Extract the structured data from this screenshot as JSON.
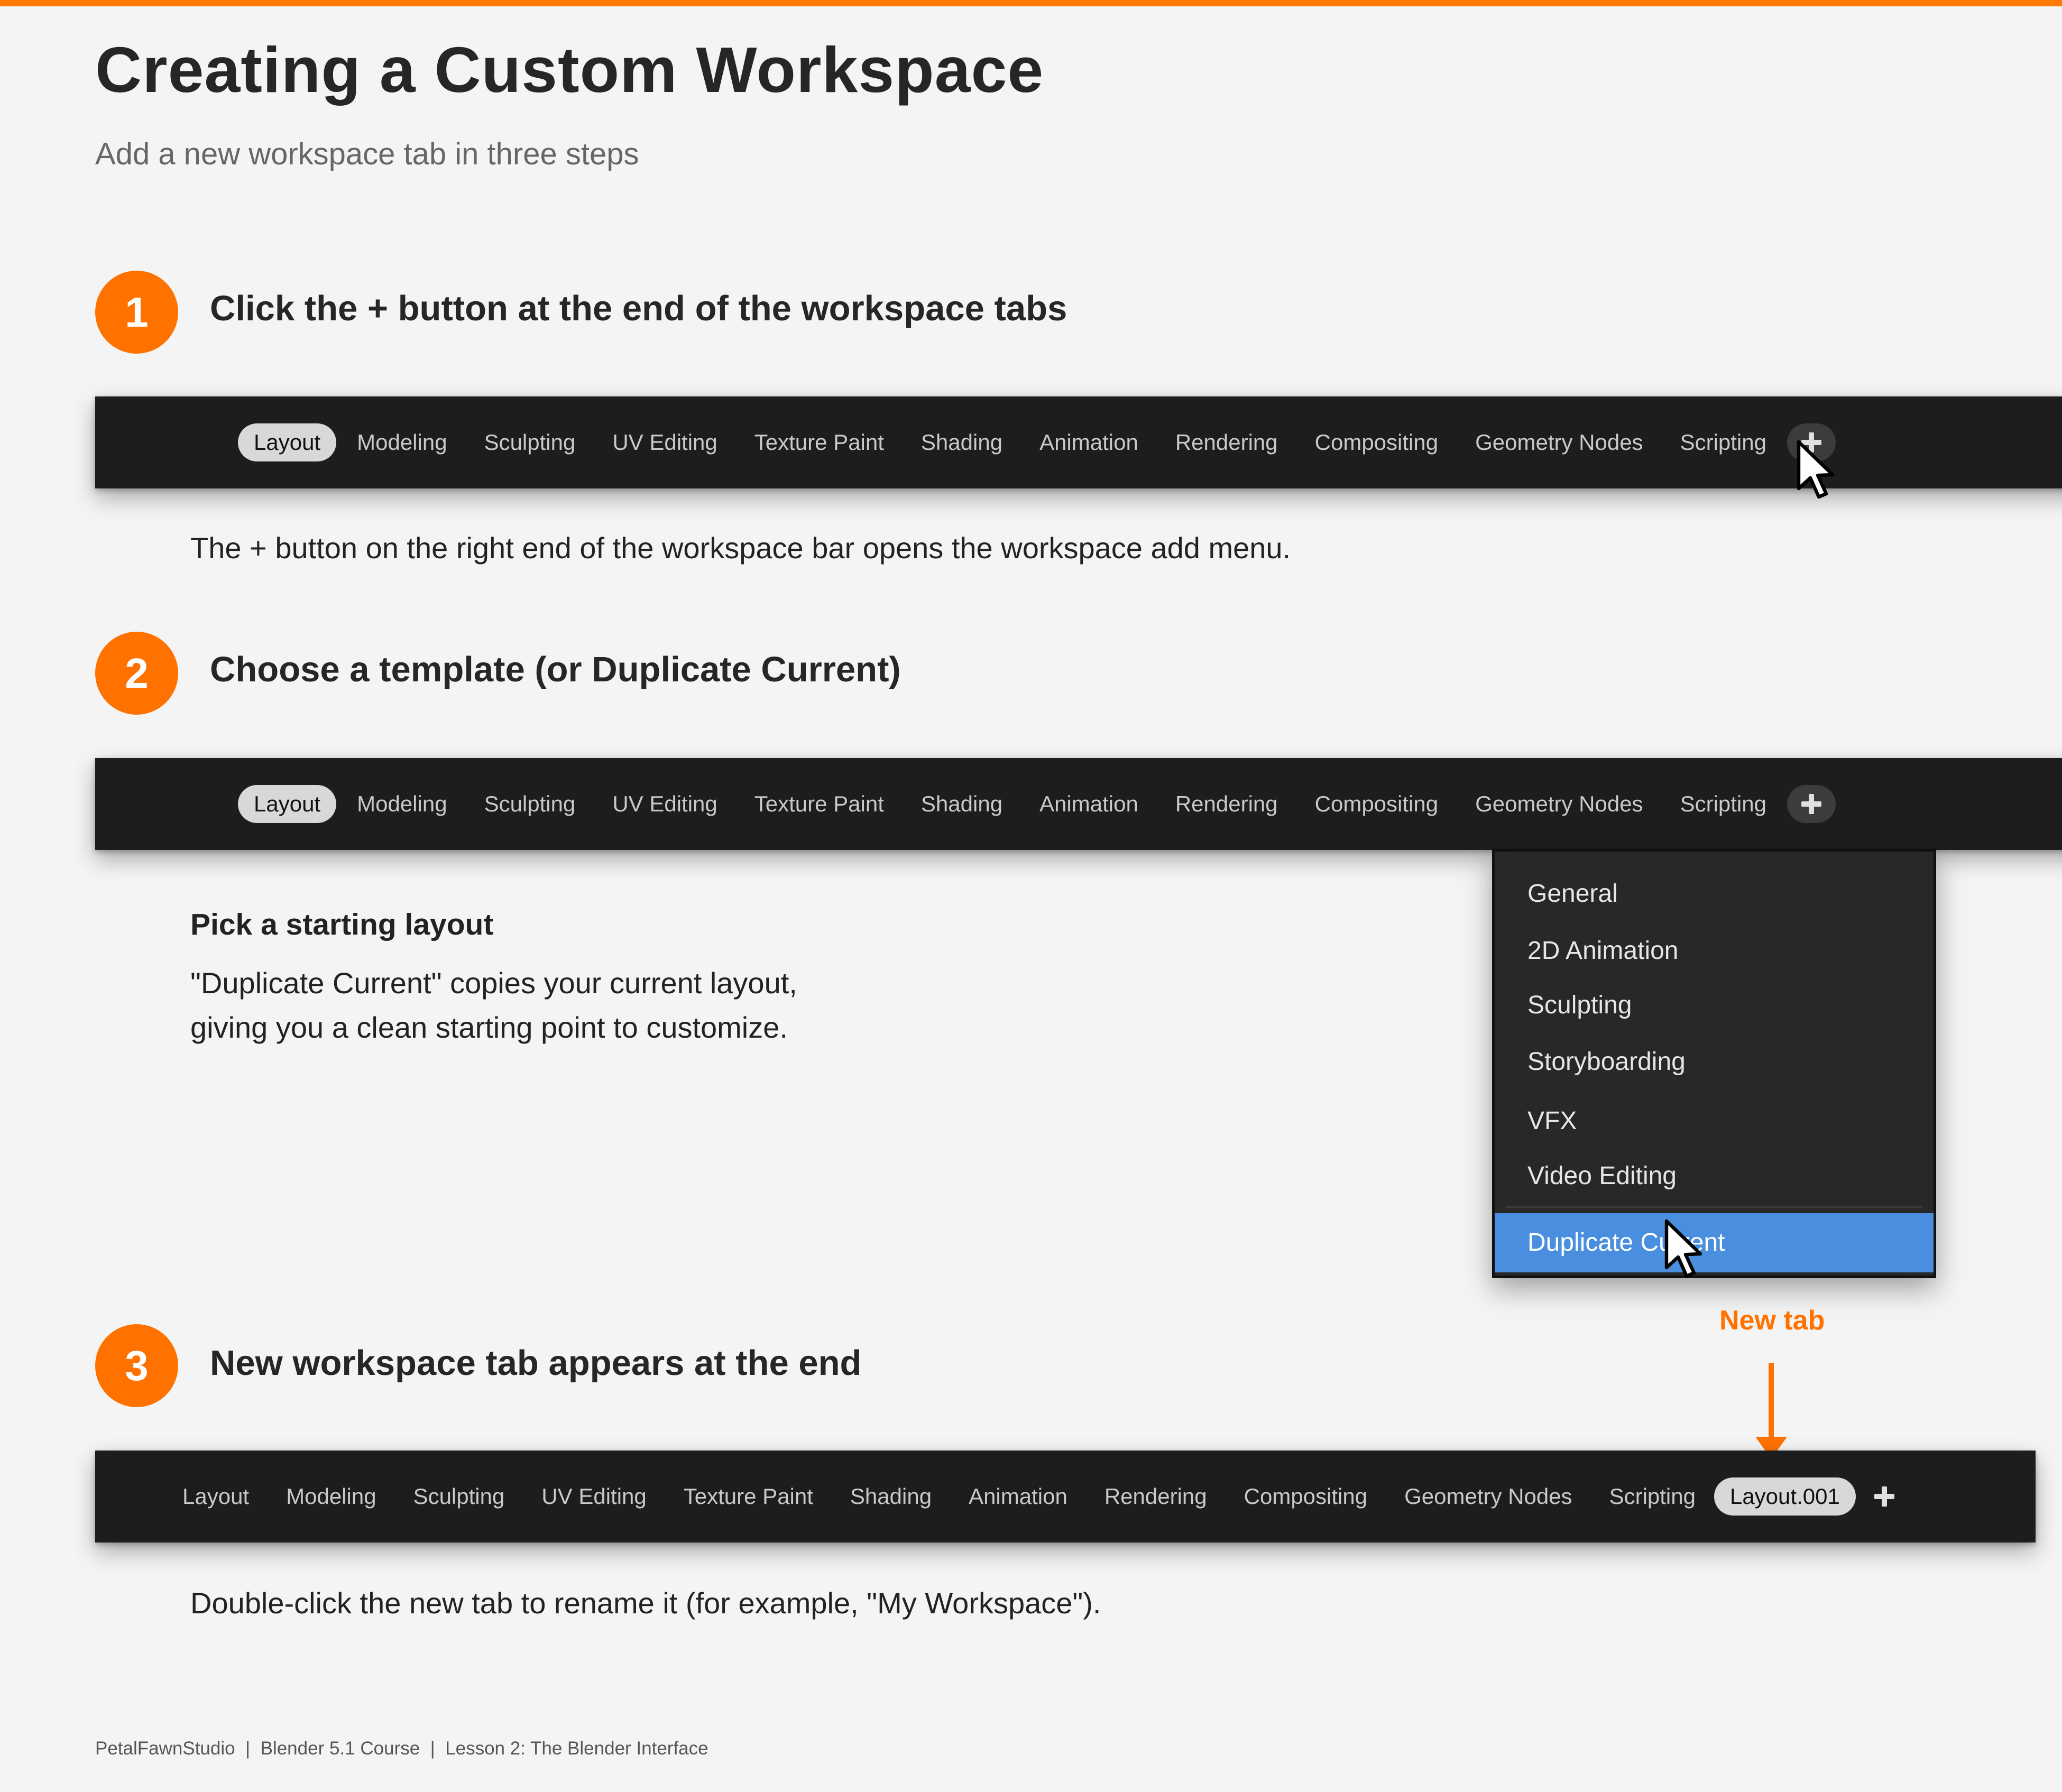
{
  "header": {
    "title": "Creating a Custom Workspace",
    "subtitle": "Add a new workspace tab in three steps"
  },
  "colors": {
    "accent": "#ff7200",
    "bar_bg": "#1d1d1d",
    "highlight": "#4a8fdf"
  },
  "step1": {
    "number": "1",
    "heading": "Click the + button at the end of the workspace tabs",
    "tabs": [
      "Layout",
      "Modeling",
      "Sculpting",
      "UV Editing",
      "Texture Paint",
      "Shading",
      "Animation",
      "Rendering",
      "Compositing",
      "Geometry Nodes",
      "Scripting"
    ],
    "active_tab": "Layout",
    "description": "The + button on the right end of the workspace bar opens the workspace add menu."
  },
  "step2": {
    "number": "2",
    "heading": "Choose a template (or Duplicate Current)",
    "tabs": [
      "Layout",
      "Modeling",
      "Sculpting",
      "UV Editing",
      "Texture Paint",
      "Shading",
      "Animation",
      "Rendering",
      "Compositing",
      "Geometry Nodes",
      "Scripting"
    ],
    "active_tab": "Layout",
    "sub_heading": "Pick a starting layout",
    "paragraph_line1": "\"Duplicate Current\" copies your current layout,",
    "paragraph_line2": "giving you a clean starting point to customize.",
    "menu_items": [
      "General",
      "2D Animation",
      "Sculpting",
      "Storyboarding",
      "VFX",
      "Video Editing"
    ],
    "menu_highlighted": "Duplicate Current"
  },
  "step3": {
    "number": "3",
    "heading": "New workspace tab appears at the end",
    "tabs": [
      "Layout",
      "Modeling",
      "Sculpting",
      "UV Editing",
      "Texture Paint",
      "Shading",
      "Animation",
      "Rendering",
      "Compositing",
      "Geometry Nodes",
      "Scripting",
      "Layout.001"
    ],
    "active_tab": "Layout.001",
    "callout": "New tab",
    "description": "Double-click the new tab to rename it (for example, \"My Workspace\")."
  },
  "footer": {
    "text": "PetalFawnStudio  |  Blender 5.1 Course  |  Lesson 2: The Blender Interface"
  },
  "icons": {
    "plus": "plus-icon",
    "cursor": "mouse-pointer-icon",
    "arrow": "arrow-down-icon"
  }
}
